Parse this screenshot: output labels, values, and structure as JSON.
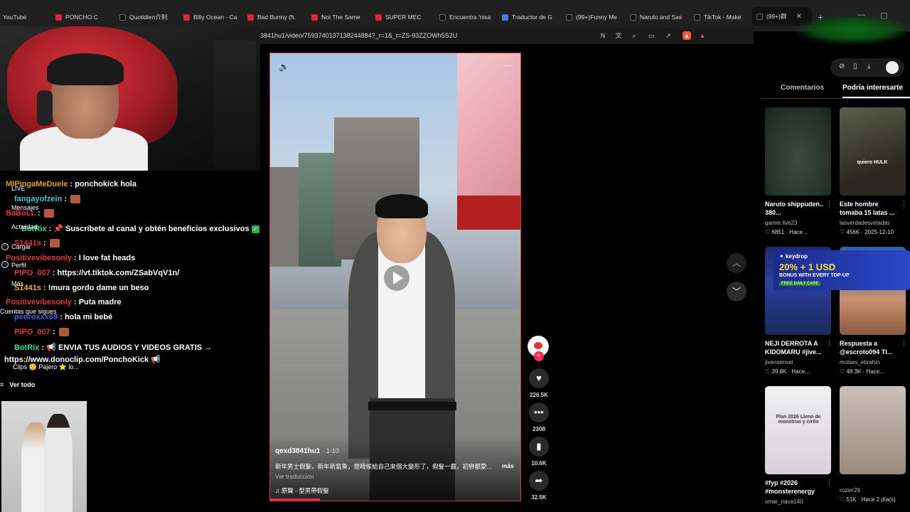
{
  "tabs": [
    {
      "label": "YouTube",
      "icon": "none"
    },
    {
      "label": "PONCHO C",
      "icon": "youtube"
    },
    {
      "label": "Quotidien介利",
      "icon": "tiktok"
    },
    {
      "label": "Billy Ocean - Ca",
      "icon": "youtube"
    },
    {
      "label": "Bad Bunny (ft.",
      "icon": "youtube"
    },
    {
      "label": "Not The Same",
      "icon": "youtube"
    },
    {
      "label": "SUPER MEC",
      "icon": "youtube"
    },
    {
      "label": "Encuentra 'nisa",
      "icon": "tiktok"
    },
    {
      "label": "Traductor de G",
      "icon": "translate"
    },
    {
      "label": "(99+)Funny Me",
      "icon": "tiktok"
    },
    {
      "label": "Naruto and Sas",
      "icon": "tiktok"
    },
    {
      "label": "TikTok - Make",
      "icon": "tiktok"
    },
    {
      "label": "(99+)群",
      "icon": "tiktok"
    }
  ],
  "address": {
    "url": "3841hu1/video/7593740137138244884?_r=1&_t=ZS-93ZZOWh5S2U"
  },
  "chat": {
    "lines": [
      {
        "user": "MIPingaMeDuele",
        "color": "#e89a2c",
        "text": "ponchokick hola",
        "emote": false
      },
      {
        "user": "fangayofzein",
        "color": "#3ec7d9",
        "text": "",
        "emote": true
      },
      {
        "user": "BaBoLL",
        "color": "#e0393e",
        "text": "",
        "emote": true
      },
      {
        "user": "BotRix",
        "color": "#2fe0a0",
        "text": "📌 Suscríbete al canal y obtén beneficios exclusivos",
        "emote": false,
        "check": true
      },
      {
        "user": "S1441s",
        "color": "#e0393e",
        "text": "",
        "emote": true
      },
      {
        "user": "Positivevibesonly",
        "color": "#e0393e",
        "text": "I love fat heads",
        "emote": false
      },
      {
        "user": "PIPO_007",
        "color": "#e0393e",
        "text": "https://vt.tiktok.com/ZSabVqV1n/",
        "emote": false
      },
      {
        "user": "S1441s",
        "color": "#e8b02c",
        "text": "!mura gordo dame un beso",
        "emote": false
      },
      {
        "user": "Positivevibesonly",
        "color": "#e0393e",
        "text": "Puta madre",
        "emote": false
      },
      {
        "user": "pedroxxx69",
        "color": "#4a5ad9",
        "text": "hola mi bebé",
        "emote": false
      },
      {
        "user": "PIPO_007",
        "color": "#e0393e",
        "text": "",
        "emote": true
      },
      {
        "user": "BotRix",
        "color": "#2fe0a0",
        "text": "📢 ENVIA TUS AUDIOS Y VIDEOS GRATIS →",
        "emote": false
      },
      {
        "user": "",
        "color": "#fff",
        "text": "https://www.donoclip.com/PonchoKick 📢",
        "emote": false
      }
    ],
    "side_labels": [
      "LIVE",
      "Mensajes",
      "Actividad",
      "Cargar",
      "Perfil",
      "Más",
      "Cuentas que sigues",
      "Clips 🙂 Pajero ⭐ lo..."
    ],
    "ver_todo": "Ver todo"
  },
  "video": {
    "author": "qexd3841hu1",
    "date": "· 1-10",
    "description": "新年男士假髮，新年新氣象，是時候給自己來個大變形了，假髮一戴，初戀都愛...",
    "more": "más",
    "translate": "Ver traducción",
    "music": "♫ 原聲 - 型男帶假髮",
    "progress": 0.2
  },
  "actions": {
    "likes": "226.5K",
    "comments": "2308",
    "saves": "10.6K",
    "shares": "32.5K"
  },
  "right_panel": {
    "tabs": [
      "Comentarios",
      "Podría interesarte"
    ],
    "cards": [
      {
        "title": "Naruto shippuden.. 380...",
        "author": "gamer.live23",
        "meta": "♡ 6851 · Hace..."
      },
      {
        "title": "Este hombre tomaba 15 latas ...",
        "author": "lasverdadesveladas",
        "meta": "♡ 456K · 2025-12-10"
      },
      {
        "title": "NEJI DERROTA A KIDOMARU #jive...",
        "author": "jivensensei",
        "meta": "♡ 39.8K · Hace..."
      },
      {
        "title": "Respuesta a @escroto094 TI...",
        "author": "moises_ebrahin",
        "meta": "♡ 48.3K · Hace..."
      },
      {
        "title": "#fyp #2026 #monsterenergy",
        "author": "omar_nava140",
        "meta": ""
      },
      {
        "title": "",
        "author": "rozier29",
        "meta": "♡ 51K · Hace 2 día(s)"
      }
    ],
    "banner": {
      "logo": "✦ keydrop",
      "promo": "20% + 1 USD",
      "bonus": "BONUS WITH EVERY TOP-UP",
      "free": "FREE DAILY CASE"
    },
    "overlay_texts": [
      "quiero HULK",
      "Plan 2026 Lleno de monstruo y cirilo"
    ]
  }
}
